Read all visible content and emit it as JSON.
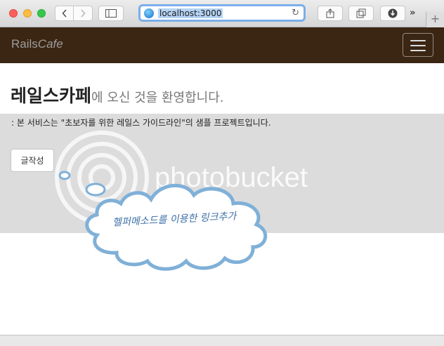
{
  "browser": {
    "url_host": "localhost",
    "url_port": ":3000",
    "back_icon": "chevron-left-icon",
    "forward_icon": "chevron-right-icon",
    "more_label": "»",
    "newtab_label": "+"
  },
  "navbar": {
    "brand_prefix": "Rails",
    "brand_suffix": "Cafe",
    "bg_color": "#3b2513"
  },
  "main": {
    "title": "레일스카페",
    "subtitle": "에 오신 것을 환영합니다.",
    "description": ": 본 서비스는 \"초보자를 위한 레일스 가이드라인\"의 샘플 프로젝트입니다.",
    "write_button": "글작성"
  },
  "watermark": {
    "text": "photobucket"
  },
  "annotation": {
    "text": "헬퍼메소드를 이용한 링크추가"
  }
}
